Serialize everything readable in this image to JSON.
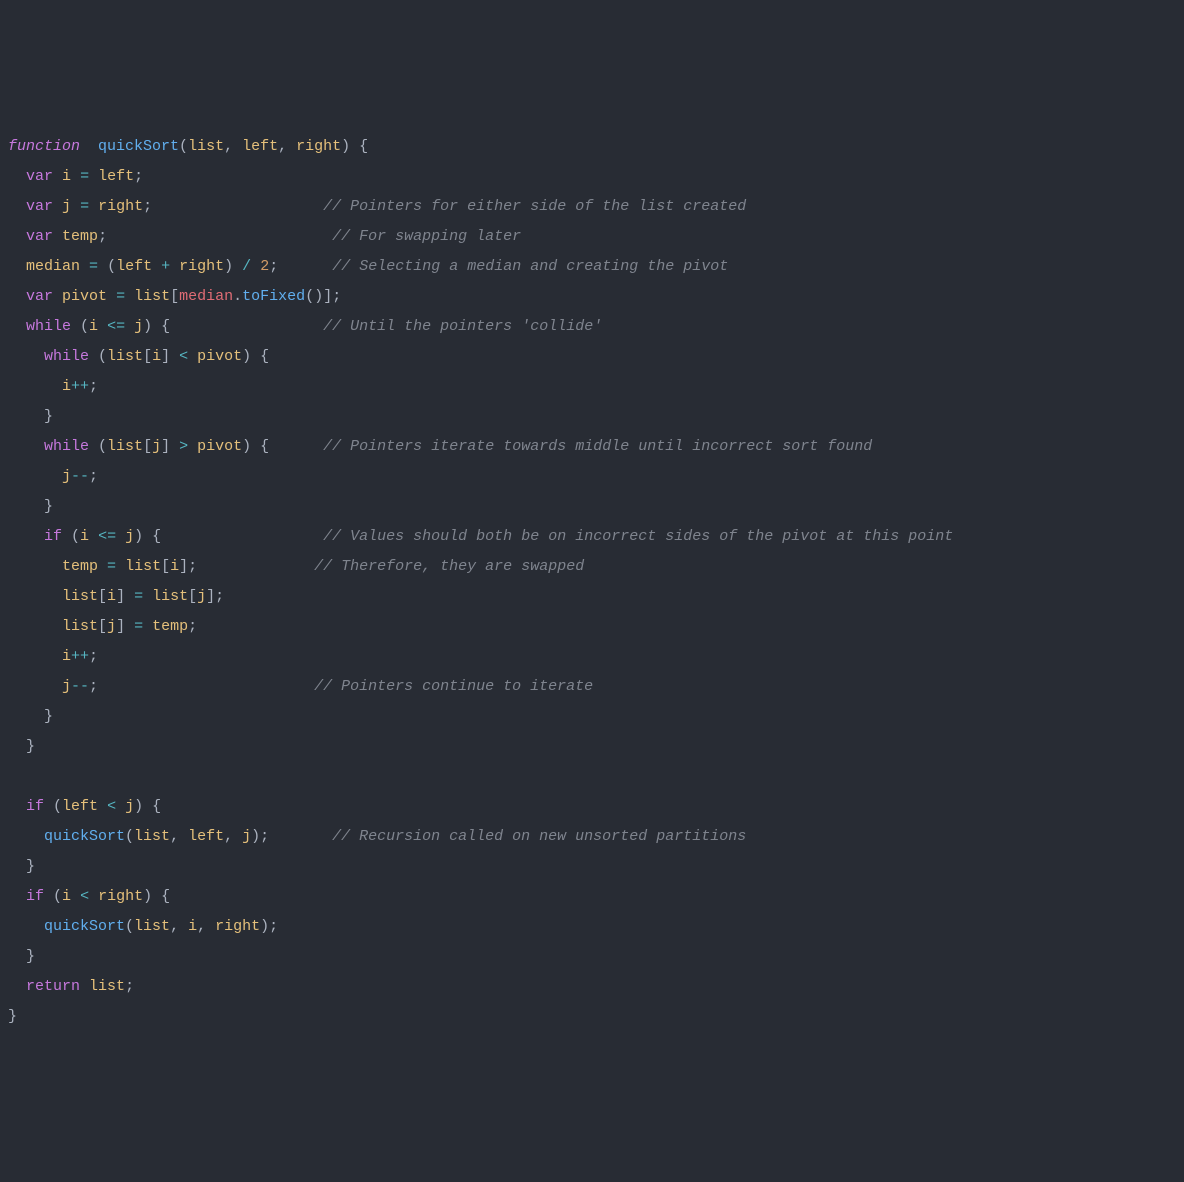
{
  "code": {
    "lines": [
      [
        {
          "cls": "k",
          "t": "function"
        },
        {
          "cls": "d",
          "t": "  "
        },
        {
          "cls": "fn",
          "t": "quickSort"
        },
        {
          "cls": "d",
          "t": "("
        },
        {
          "cls": "v",
          "t": "list"
        },
        {
          "cls": "d",
          "t": ", "
        },
        {
          "cls": "v",
          "t": "left"
        },
        {
          "cls": "d",
          "t": ", "
        },
        {
          "cls": "v",
          "t": "right"
        },
        {
          "cls": "d",
          "t": ") {"
        }
      ],
      [
        {
          "cls": "d",
          "t": "  "
        },
        {
          "cls": "kw",
          "t": "var"
        },
        {
          "cls": "d",
          "t": " "
        },
        {
          "cls": "v",
          "t": "i"
        },
        {
          "cls": "d",
          "t": " "
        },
        {
          "cls": "op",
          "t": "="
        },
        {
          "cls": "d",
          "t": " "
        },
        {
          "cls": "v",
          "t": "left"
        },
        {
          "cls": "d",
          "t": ";"
        }
      ],
      [
        {
          "cls": "d",
          "t": "  "
        },
        {
          "cls": "kw",
          "t": "var"
        },
        {
          "cls": "d",
          "t": " "
        },
        {
          "cls": "v",
          "t": "j"
        },
        {
          "cls": "d",
          "t": " "
        },
        {
          "cls": "op",
          "t": "="
        },
        {
          "cls": "d",
          "t": " "
        },
        {
          "cls": "v",
          "t": "right"
        },
        {
          "cls": "d",
          "t": ";                   "
        },
        {
          "cls": "c",
          "t": "// Pointers for either side of the list created"
        }
      ],
      [
        {
          "cls": "d",
          "t": "  "
        },
        {
          "cls": "kw",
          "t": "var"
        },
        {
          "cls": "d",
          "t": " "
        },
        {
          "cls": "v",
          "t": "temp"
        },
        {
          "cls": "d",
          "t": ";                         "
        },
        {
          "cls": "c",
          "t": "// For swapping later"
        }
      ],
      [
        {
          "cls": "d",
          "t": "  "
        },
        {
          "cls": "v",
          "t": "median"
        },
        {
          "cls": "d",
          "t": " "
        },
        {
          "cls": "op",
          "t": "="
        },
        {
          "cls": "d",
          "t": " ("
        },
        {
          "cls": "v",
          "t": "left"
        },
        {
          "cls": "d",
          "t": " "
        },
        {
          "cls": "op",
          "t": "+"
        },
        {
          "cls": "d",
          "t": " "
        },
        {
          "cls": "v",
          "t": "right"
        },
        {
          "cls": "d",
          "t": ") "
        },
        {
          "cls": "op",
          "t": "/"
        },
        {
          "cls": "d",
          "t": " "
        },
        {
          "cls": "n",
          "t": "2"
        },
        {
          "cls": "d",
          "t": ";      "
        },
        {
          "cls": "c",
          "t": "// Selecting a median and creating the pivot"
        }
      ],
      [
        {
          "cls": "d",
          "t": "  "
        },
        {
          "cls": "kw",
          "t": "var"
        },
        {
          "cls": "d",
          "t": " "
        },
        {
          "cls": "v",
          "t": "pivot"
        },
        {
          "cls": "d",
          "t": " "
        },
        {
          "cls": "op",
          "t": "="
        },
        {
          "cls": "d",
          "t": " "
        },
        {
          "cls": "v",
          "t": "list"
        },
        {
          "cls": "d",
          "t": "["
        },
        {
          "cls": "e",
          "t": "median"
        },
        {
          "cls": "d",
          "t": "."
        },
        {
          "cls": "fn",
          "t": "toFixed"
        },
        {
          "cls": "d",
          "t": "()];"
        }
      ],
      [
        {
          "cls": "d",
          "t": "  "
        },
        {
          "cls": "kw",
          "t": "while"
        },
        {
          "cls": "d",
          "t": " ("
        },
        {
          "cls": "v",
          "t": "i"
        },
        {
          "cls": "d",
          "t": " "
        },
        {
          "cls": "op",
          "t": "<="
        },
        {
          "cls": "d",
          "t": " "
        },
        {
          "cls": "v",
          "t": "j"
        },
        {
          "cls": "d",
          "t": ") {                 "
        },
        {
          "cls": "c",
          "t": "// Until the pointers 'collide'"
        }
      ],
      [
        {
          "cls": "d",
          "t": "    "
        },
        {
          "cls": "kw",
          "t": "while"
        },
        {
          "cls": "d",
          "t": " ("
        },
        {
          "cls": "v",
          "t": "list"
        },
        {
          "cls": "d",
          "t": "["
        },
        {
          "cls": "v",
          "t": "i"
        },
        {
          "cls": "d",
          "t": "] "
        },
        {
          "cls": "op",
          "t": "<"
        },
        {
          "cls": "d",
          "t": " "
        },
        {
          "cls": "v",
          "t": "pivot"
        },
        {
          "cls": "d",
          "t": ") {"
        }
      ],
      [
        {
          "cls": "d",
          "t": "      "
        },
        {
          "cls": "v",
          "t": "i"
        },
        {
          "cls": "op",
          "t": "++"
        },
        {
          "cls": "d",
          "t": ";"
        }
      ],
      [
        {
          "cls": "d",
          "t": "    }"
        }
      ],
      [
        {
          "cls": "d",
          "t": "    "
        },
        {
          "cls": "kw",
          "t": "while"
        },
        {
          "cls": "d",
          "t": " ("
        },
        {
          "cls": "v",
          "t": "list"
        },
        {
          "cls": "d",
          "t": "["
        },
        {
          "cls": "v",
          "t": "j"
        },
        {
          "cls": "d",
          "t": "] "
        },
        {
          "cls": "op",
          "t": ">"
        },
        {
          "cls": "d",
          "t": " "
        },
        {
          "cls": "v",
          "t": "pivot"
        },
        {
          "cls": "d",
          "t": ") {      "
        },
        {
          "cls": "c",
          "t": "// Pointers iterate towards middle until incorrect sort found"
        }
      ],
      [
        {
          "cls": "d",
          "t": "      "
        },
        {
          "cls": "v",
          "t": "j"
        },
        {
          "cls": "op",
          "t": "--"
        },
        {
          "cls": "d",
          "t": ";"
        }
      ],
      [
        {
          "cls": "d",
          "t": "    }"
        }
      ],
      [
        {
          "cls": "d",
          "t": "    "
        },
        {
          "cls": "kw",
          "t": "if"
        },
        {
          "cls": "d",
          "t": " ("
        },
        {
          "cls": "v",
          "t": "i"
        },
        {
          "cls": "d",
          "t": " "
        },
        {
          "cls": "op",
          "t": "<="
        },
        {
          "cls": "d",
          "t": " "
        },
        {
          "cls": "v",
          "t": "j"
        },
        {
          "cls": "d",
          "t": ") {                  "
        },
        {
          "cls": "c",
          "t": "// Values should both be on incorrect sides of the pivot at this point"
        }
      ],
      [
        {
          "cls": "d",
          "t": "      "
        },
        {
          "cls": "v",
          "t": "temp"
        },
        {
          "cls": "d",
          "t": " "
        },
        {
          "cls": "op",
          "t": "="
        },
        {
          "cls": "d",
          "t": " "
        },
        {
          "cls": "v",
          "t": "list"
        },
        {
          "cls": "d",
          "t": "["
        },
        {
          "cls": "v",
          "t": "i"
        },
        {
          "cls": "d",
          "t": "];             "
        },
        {
          "cls": "c",
          "t": "// Therefore, they are swapped"
        }
      ],
      [
        {
          "cls": "d",
          "t": "      "
        },
        {
          "cls": "v",
          "t": "list"
        },
        {
          "cls": "d",
          "t": "["
        },
        {
          "cls": "v",
          "t": "i"
        },
        {
          "cls": "d",
          "t": "] "
        },
        {
          "cls": "op",
          "t": "="
        },
        {
          "cls": "d",
          "t": " "
        },
        {
          "cls": "v",
          "t": "list"
        },
        {
          "cls": "d",
          "t": "["
        },
        {
          "cls": "v",
          "t": "j"
        },
        {
          "cls": "d",
          "t": "];"
        }
      ],
      [
        {
          "cls": "d",
          "t": "      "
        },
        {
          "cls": "v",
          "t": "list"
        },
        {
          "cls": "d",
          "t": "["
        },
        {
          "cls": "v",
          "t": "j"
        },
        {
          "cls": "d",
          "t": "] "
        },
        {
          "cls": "op",
          "t": "="
        },
        {
          "cls": "d",
          "t": " "
        },
        {
          "cls": "v",
          "t": "temp"
        },
        {
          "cls": "d",
          "t": ";"
        }
      ],
      [
        {
          "cls": "d",
          "t": "      "
        },
        {
          "cls": "v",
          "t": "i"
        },
        {
          "cls": "op",
          "t": "++"
        },
        {
          "cls": "d",
          "t": ";"
        }
      ],
      [
        {
          "cls": "d",
          "t": "      "
        },
        {
          "cls": "v",
          "t": "j"
        },
        {
          "cls": "op",
          "t": "--"
        },
        {
          "cls": "d",
          "t": ";                        "
        },
        {
          "cls": "c",
          "t": "// Pointers continue to iterate"
        }
      ],
      [
        {
          "cls": "d",
          "t": "    }"
        }
      ],
      [
        {
          "cls": "d",
          "t": "  }"
        }
      ],
      [
        {
          "cls": "d",
          "t": ""
        }
      ],
      [
        {
          "cls": "d",
          "t": "  "
        },
        {
          "cls": "kw",
          "t": "if"
        },
        {
          "cls": "d",
          "t": " ("
        },
        {
          "cls": "v",
          "t": "left"
        },
        {
          "cls": "d",
          "t": " "
        },
        {
          "cls": "op",
          "t": "<"
        },
        {
          "cls": "d",
          "t": " "
        },
        {
          "cls": "v",
          "t": "j"
        },
        {
          "cls": "d",
          "t": ") {"
        }
      ],
      [
        {
          "cls": "d",
          "t": "    "
        },
        {
          "cls": "fn",
          "t": "quickSort"
        },
        {
          "cls": "d",
          "t": "("
        },
        {
          "cls": "v",
          "t": "list"
        },
        {
          "cls": "d",
          "t": ", "
        },
        {
          "cls": "v",
          "t": "left"
        },
        {
          "cls": "d",
          "t": ", "
        },
        {
          "cls": "v",
          "t": "j"
        },
        {
          "cls": "d",
          "t": ");       "
        },
        {
          "cls": "c",
          "t": "// Recursion called on new unsorted partitions"
        }
      ],
      [
        {
          "cls": "d",
          "t": "  }"
        }
      ],
      [
        {
          "cls": "d",
          "t": "  "
        },
        {
          "cls": "kw",
          "t": "if"
        },
        {
          "cls": "d",
          "t": " ("
        },
        {
          "cls": "v",
          "t": "i"
        },
        {
          "cls": "d",
          "t": " "
        },
        {
          "cls": "op",
          "t": "<"
        },
        {
          "cls": "d",
          "t": " "
        },
        {
          "cls": "v",
          "t": "right"
        },
        {
          "cls": "d",
          "t": ") {"
        }
      ],
      [
        {
          "cls": "d",
          "t": "    "
        },
        {
          "cls": "fn",
          "t": "quickSort"
        },
        {
          "cls": "d",
          "t": "("
        },
        {
          "cls": "v",
          "t": "list"
        },
        {
          "cls": "d",
          "t": ", "
        },
        {
          "cls": "v",
          "t": "i"
        },
        {
          "cls": "d",
          "t": ", "
        },
        {
          "cls": "v",
          "t": "right"
        },
        {
          "cls": "d",
          "t": ");"
        }
      ],
      [
        {
          "cls": "d",
          "t": "  }"
        }
      ],
      [
        {
          "cls": "d",
          "t": "  "
        },
        {
          "cls": "kw",
          "t": "return"
        },
        {
          "cls": "d",
          "t": " "
        },
        {
          "cls": "v",
          "t": "list"
        },
        {
          "cls": "d",
          "t": ";"
        }
      ],
      [
        {
          "cls": "d",
          "t": "}"
        }
      ]
    ]
  }
}
